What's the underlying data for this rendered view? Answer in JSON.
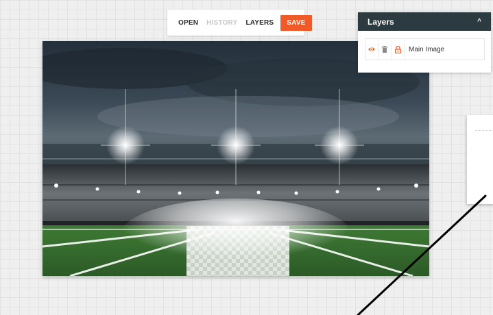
{
  "toolbar": {
    "open_label": "OPEN",
    "history_label": "HISTORY",
    "layers_label": "LAYERS",
    "save_label": "SAVE"
  },
  "layers_panel": {
    "title": "Layers",
    "items": [
      {
        "name": "Main Image",
        "icons": [
          "eye-icon",
          "trash-icon",
          "lock-icon"
        ]
      }
    ]
  },
  "colors": {
    "accent": "#f05a28",
    "panel_header": "#2b3b3f",
    "canvas_bg": "#efefef"
  }
}
